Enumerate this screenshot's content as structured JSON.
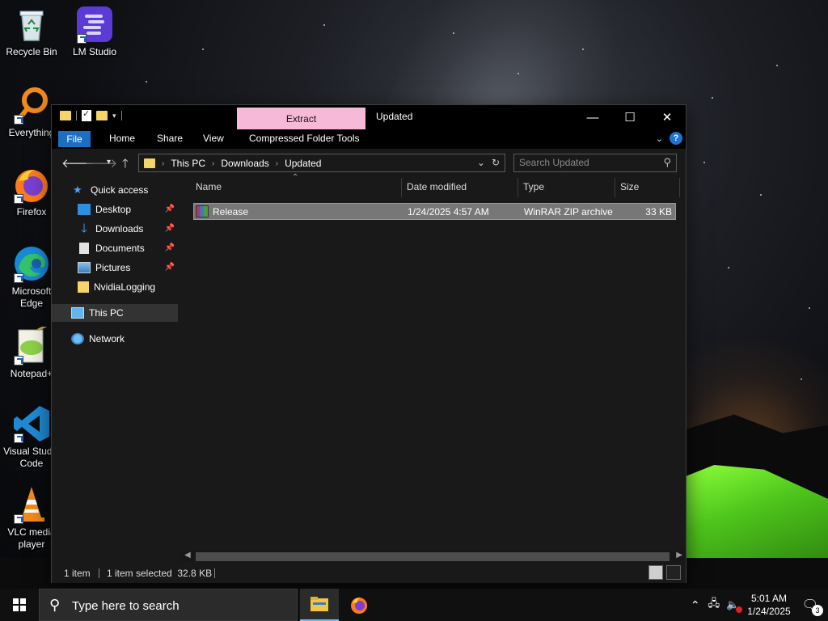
{
  "desktop": {
    "icons": [
      {
        "label": "Recycle Bin"
      },
      {
        "label": "LM Studio"
      },
      {
        "label": "Everything"
      },
      {
        "label": "Firefox"
      },
      {
        "label": "Microsoft Edge"
      },
      {
        "label": "Notepad+"
      },
      {
        "label": "Visual Studio Code"
      },
      {
        "label": "VLC media player"
      }
    ]
  },
  "window": {
    "title": "Updated",
    "context_tab": "Extract",
    "ribbon_tabs": [
      "File",
      "Home",
      "Share",
      "View",
      "Compressed Folder Tools"
    ],
    "caption": {
      "minimize": "—",
      "maximize": "☐",
      "close": "✕"
    },
    "help": "?"
  },
  "address": {
    "crumbs": [
      "This PC",
      "Downloads",
      "Updated"
    ],
    "search_placeholder": "Search Updated"
  },
  "nav_pane": {
    "items": [
      {
        "label": "Quick access"
      },
      {
        "label": "Desktop"
      },
      {
        "label": "Downloads"
      },
      {
        "label": "Documents"
      },
      {
        "label": "Pictures"
      },
      {
        "label": "NvidiaLogging"
      },
      {
        "label": "This PC"
      },
      {
        "label": "Network"
      }
    ]
  },
  "columns": [
    "Name",
    "Date modified",
    "Type",
    "Size"
  ],
  "files": [
    {
      "name": "Release",
      "date": "1/24/2025 4:57 AM",
      "type": "WinRAR ZIP archive",
      "size": "33 KB"
    }
  ],
  "status": {
    "count": "1 item",
    "selected": "1 item selected  32.8 KB"
  },
  "taskbar": {
    "search_placeholder": "Type here to search",
    "time": "5:01 AM",
    "date": "1/24/2025",
    "notifications": "3"
  },
  "colors": {
    "accent": "#1b6ec2",
    "extract_tab": "#f7b9d8",
    "window_bg": "#191919",
    "selection": "#777777"
  }
}
